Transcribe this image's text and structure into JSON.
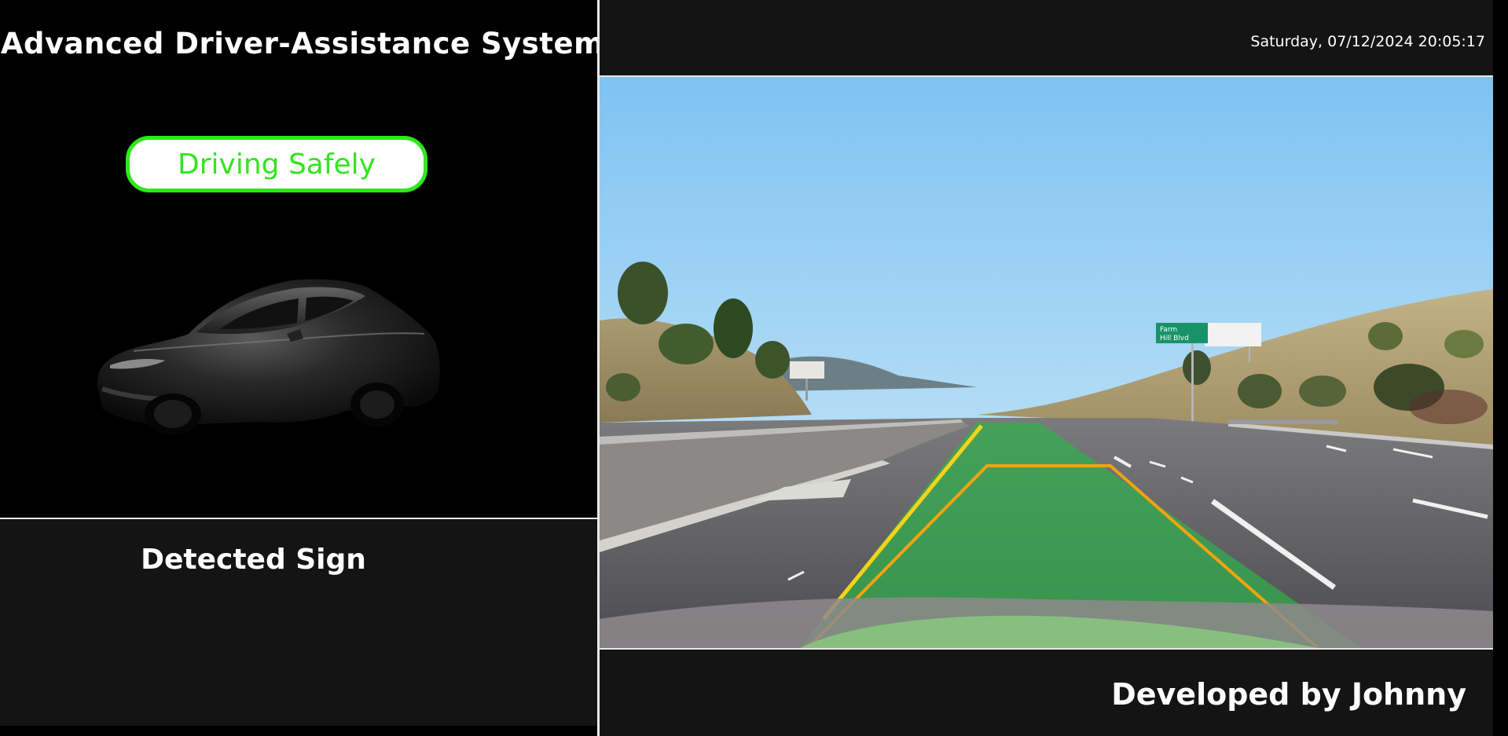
{
  "header": {
    "title": "Advanced Driver-Assistance System",
    "datetime": "Saturday, 07/12/2024 20:05:17"
  },
  "status": {
    "label": "Driving Safely",
    "color": "#2fe81b"
  },
  "sign_panel": {
    "heading": "Detected Sign"
  },
  "road_sign": {
    "lines": [
      "Farm",
      "Hill Blvd"
    ]
  },
  "footer": {
    "credit": "Developed by Johnny"
  },
  "colors": {
    "lane_fill": "#2fb24a",
    "lane_outline": "#f2a30f",
    "lane_edge": "#f5d21a",
    "badge_border": "#2fe81b",
    "badge_text": "#33e51e"
  }
}
